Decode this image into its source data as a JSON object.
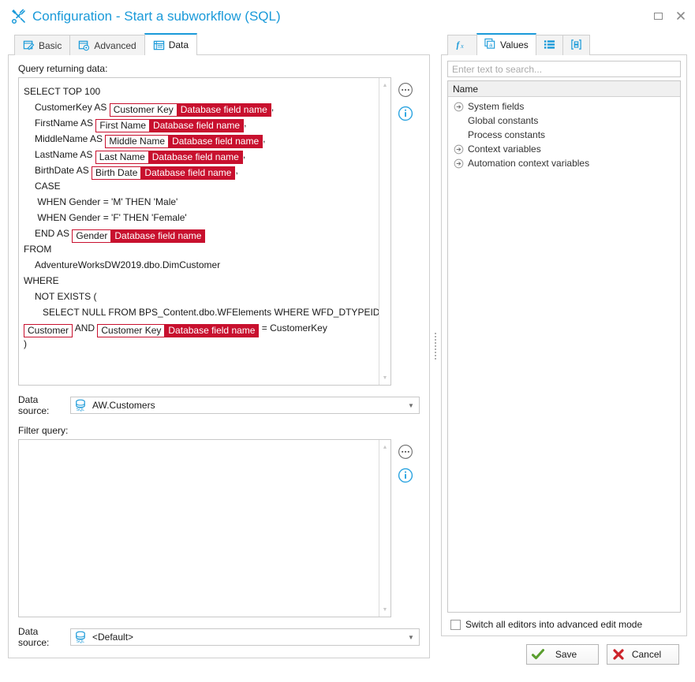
{
  "window": {
    "title": "Configuration - Start a subworkflow (SQL)",
    "title_icon": "tools-icon",
    "maximize_label": "Maximize",
    "close_label": "Close"
  },
  "left": {
    "tabs": [
      {
        "label": "Basic",
        "icon": "form-pencil-icon",
        "active": false
      },
      {
        "label": "Advanced",
        "icon": "form-gear-icon",
        "active": false
      },
      {
        "label": "Data",
        "icon": "grid-icon",
        "active": true
      }
    ],
    "query_label": "Query returning data:",
    "query_lines": [
      {
        "indent": 0,
        "parts": [
          {
            "type": "text",
            "text": "SELECT TOP 100"
          }
        ]
      },
      {
        "indent": 1,
        "parts": [
          {
            "type": "text",
            "text": "CustomerKey AS "
          },
          {
            "type": "token",
            "name": "Customer Key",
            "kind": "Database field name"
          },
          {
            "type": "text",
            "text": ","
          }
        ]
      },
      {
        "indent": 1,
        "parts": [
          {
            "type": "text",
            "text": "FirstName AS "
          },
          {
            "type": "token",
            "name": "First Name",
            "kind": "Database field name"
          },
          {
            "type": "text",
            "text": ","
          }
        ]
      },
      {
        "indent": 1,
        "parts": [
          {
            "type": "text",
            "text": "MiddleName AS "
          },
          {
            "type": "token",
            "name": "Middle Name",
            "kind": "Database field name"
          },
          {
            "type": "text",
            "text": ","
          }
        ]
      },
      {
        "indent": 1,
        "parts": [
          {
            "type": "text",
            "text": "LastName AS "
          },
          {
            "type": "token",
            "name": "Last Name",
            "kind": "Database field name"
          },
          {
            "type": "text",
            "text": ","
          }
        ]
      },
      {
        "indent": 1,
        "parts": [
          {
            "type": "text",
            "text": "BirthDate AS "
          },
          {
            "type": "token",
            "name": "Birth Date",
            "kind": "Database field name"
          },
          {
            "type": "text",
            "text": ","
          }
        ]
      },
      {
        "indent": 1,
        "parts": [
          {
            "type": "text",
            "text": "CASE"
          }
        ]
      },
      {
        "indent": 1,
        "parts": [
          {
            "type": "text",
            "text": " WHEN Gender = 'M' THEN 'Male'"
          }
        ]
      },
      {
        "indent": 1,
        "parts": [
          {
            "type": "text",
            "text": " WHEN Gender = 'F' THEN 'Female'"
          }
        ]
      },
      {
        "indent": 1,
        "parts": [
          {
            "type": "text",
            "text": "END AS "
          },
          {
            "type": "token",
            "name": "Gender",
            "kind": "Database field name"
          }
        ]
      },
      {
        "indent": 0,
        "parts": [
          {
            "type": "text",
            "text": "FROM"
          }
        ]
      },
      {
        "indent": 1,
        "parts": [
          {
            "type": "text",
            "text": "AdventureWorksDW2019.dbo.DimCustomer"
          }
        ]
      },
      {
        "indent": 0,
        "parts": [
          {
            "type": "text",
            "text": "WHERE"
          }
        ]
      },
      {
        "indent": 1,
        "parts": [
          {
            "type": "text",
            "text": "NOT EXISTS ("
          }
        ]
      },
      {
        "indent": 2,
        "parts": [
          {
            "type": "text",
            "text": "SELECT NULL FROM BPS_Content.dbo.WFElements WHERE WFD_DTYPEID ="
          }
        ]
      },
      {
        "indent": 0,
        "parts": [
          {
            "type": "token",
            "name": "Customer",
            "kind": ""
          },
          {
            "type": "text",
            "text": " AND "
          },
          {
            "type": "token",
            "name": "Customer Key",
            "kind": "Database field name"
          },
          {
            "type": "text",
            "text": " = CustomerKey"
          }
        ]
      },
      {
        "indent": 0,
        "parts": [
          {
            "type": "text",
            "text": ")"
          }
        ]
      }
    ],
    "query_more_label": "More options",
    "query_info_label": "Information",
    "datasource1": {
      "label": "Data source:",
      "icon": "sql-database-icon",
      "value": "AW.Customers"
    },
    "filter_label": "Filter query:",
    "filter_value": "",
    "filter_more_label": "More options",
    "filter_info_label": "Information",
    "datasource2": {
      "label": "Data source:",
      "icon": "sql-database-icon",
      "value": "<Default>"
    }
  },
  "right": {
    "tabs": [
      {
        "label": "",
        "icon": "function-fx-icon",
        "active": false
      },
      {
        "label": "Values",
        "icon": "values-a-icon",
        "active": true
      },
      {
        "label": "",
        "icon": "list-detail-icon",
        "active": false
      },
      {
        "label": "",
        "icon": "bracket-box-icon",
        "active": false
      }
    ],
    "search_placeholder": "Enter text to search...",
    "search_value": "",
    "tree_header": "Name",
    "tree_items": [
      {
        "label": "System fields",
        "expandable": true
      },
      {
        "label": "Global constants",
        "expandable": false
      },
      {
        "label": "Process constants",
        "expandable": false
      },
      {
        "label": "Context variables",
        "expandable": true
      },
      {
        "label": "Automation context variables",
        "expandable": true
      }
    ],
    "advanced_checkbox": {
      "label": "Switch all editors into advanced edit mode",
      "checked": false
    }
  },
  "footer": {
    "save_label": "Save",
    "cancel_label": "Cancel"
  },
  "colors": {
    "accent": "#1a9ad9",
    "token_red": "#c8102e",
    "save_green": "#5a9e2f",
    "cancel_red": "#cc2229"
  }
}
